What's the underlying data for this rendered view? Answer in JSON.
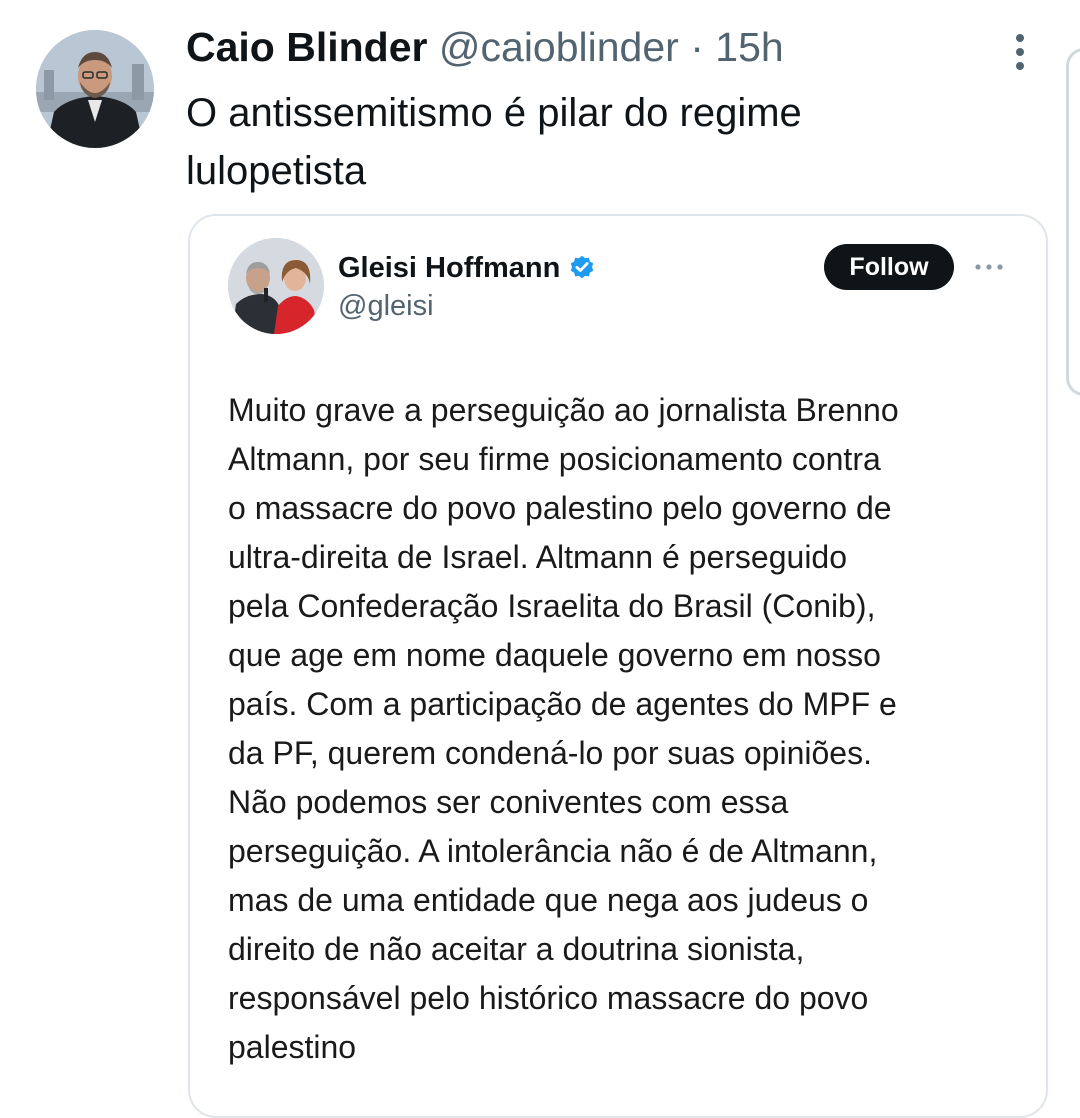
{
  "tweet": {
    "author_name": "Caio Blinder",
    "author_handle": "@caioblinder",
    "separator": "·",
    "time": "15h",
    "text": "O antissemitismo é pilar do regime lulopetista",
    "avatar_icon": "profile-photo",
    "more_icon": "more-vertical-icon"
  },
  "quoted": {
    "name": "Gleisi Hoffmann",
    "handle": "@gleisi",
    "verified": true,
    "verified_color": "#1d9bf0",
    "follow_label": "Follow",
    "more_icon": "more-horizontal-icon",
    "body": "Muito grave a perseguição ao jornalista Brenno\nAltmann, por seu firme posicionamento  contra\no massacre do povo palestino pelo governo de\nultra-direita de Israel. Altmann é perseguido\npela Confederação Israelita do Brasil (Conib),\nque age em nome daquele governo em nosso\npaís. Com a participação de agentes do MPF e\nda PF, querem condená-lo por suas opiniões.\nNão podemos  ser coniventes com essa\nperseguição. A intolerância não é de Altmann,\nmas de uma entidade que nega aos judeus o\ndireito de não aceitar a doutrina sionista,\nresponsável pelo histórico massacre do povo\npalestino"
  },
  "colors": {
    "text_primary": "#0f1419",
    "text_secondary": "#536471",
    "border": "#dfe5ea",
    "follow_bg": "#0f1419",
    "follow_text": "#ffffff"
  }
}
